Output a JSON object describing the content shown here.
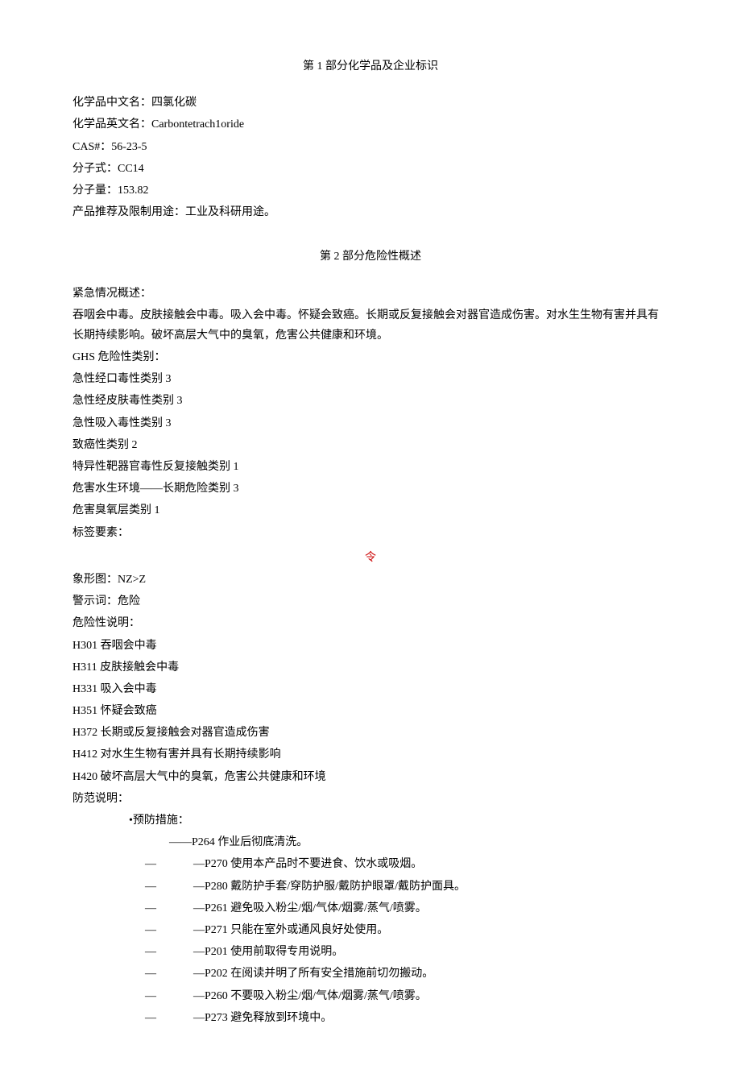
{
  "section1": {
    "title": "第 1 部分化学品及企业标识",
    "cn_name_label": "化学品中文名：",
    "cn_name_value": "四氯化碳",
    "en_name_label": "化学品英文名：",
    "en_name_value": "Carbontetrach1oride",
    "cas_label": "CAS#：",
    "cas_value": "56-23-5",
    "formula_label": "分子式：",
    "formula_value": "CC14",
    "mw_label": "分子量：",
    "mw_value": "153.82",
    "use_label": "产品推荐及限制用途：",
    "use_value": "工业及科研用途。"
  },
  "section2": {
    "title": "第 2 部分危险性概述",
    "emergency_label": "紧急情况概述：",
    "emergency_text": "吞咽会中毒。皮肤接触会中毒。吸入会中毒。怀疑会致癌。长期或反复接触会对器官造成伤害。对水生生物有害并具有长期持续影响。破坏高层大气中的臭氧，危害公共健康和环境。",
    "ghs_label": "GHS 危险性类别：",
    "ghs_categories": [
      "急性经口毒性类别 3",
      "急性经皮肤毒性类别 3",
      "急性吸入毒性类别 3",
      "致癌性类别 2",
      "特异性靶器官毒性反复接触类别 1",
      "危害水生环境——长期危险类别 3",
      "危害臭氧层类别 1"
    ],
    "label_elements": "标签要素：",
    "symbol_red": "令",
    "pictogram_label": "象形图：",
    "pictogram_value": "NZ>Z",
    "signal_label": "警示词：",
    "signal_value": "危险",
    "hazard_stmt_label": "危险性说明：",
    "hazard_statements": [
      "H301 吞咽会中毒",
      "H311 皮肤接触会中毒",
      "H331 吸入会中毒",
      "H351 怀疑会致癌",
      "H372 长期或反复接触会对器官造成伤害",
      "H412 对水生生物有害并具有长期持续影响",
      "H420 破坏高层大气中的臭氧，危害公共健康和环境"
    ],
    "precaution_label": "防范说明：",
    "precaution_sub": "•预防措施：",
    "first_precaution": "——P264 作业后彻底清洗。",
    "precautions": [
      "—P270 使用本产品时不要进食、饮水或吸烟。",
      "—P280 戴防护手套/穿防护服/戴防护眼罩/戴防护面具。",
      "—P261 避免吸入粉尘/烟/气体/烟雾/蒸气/喷雾。",
      "—P271 只能在室外或通风良好处使用。",
      "—P201 使用前取得专用说明。",
      "—P202 在阅读并明了所有安全措施前切勿搬动。",
      "—P260 不要吸入粉尘/烟/气体/烟雾/蒸气/喷雾。",
      "—P273 避免释放到环境中。"
    ],
    "dash": "—"
  }
}
